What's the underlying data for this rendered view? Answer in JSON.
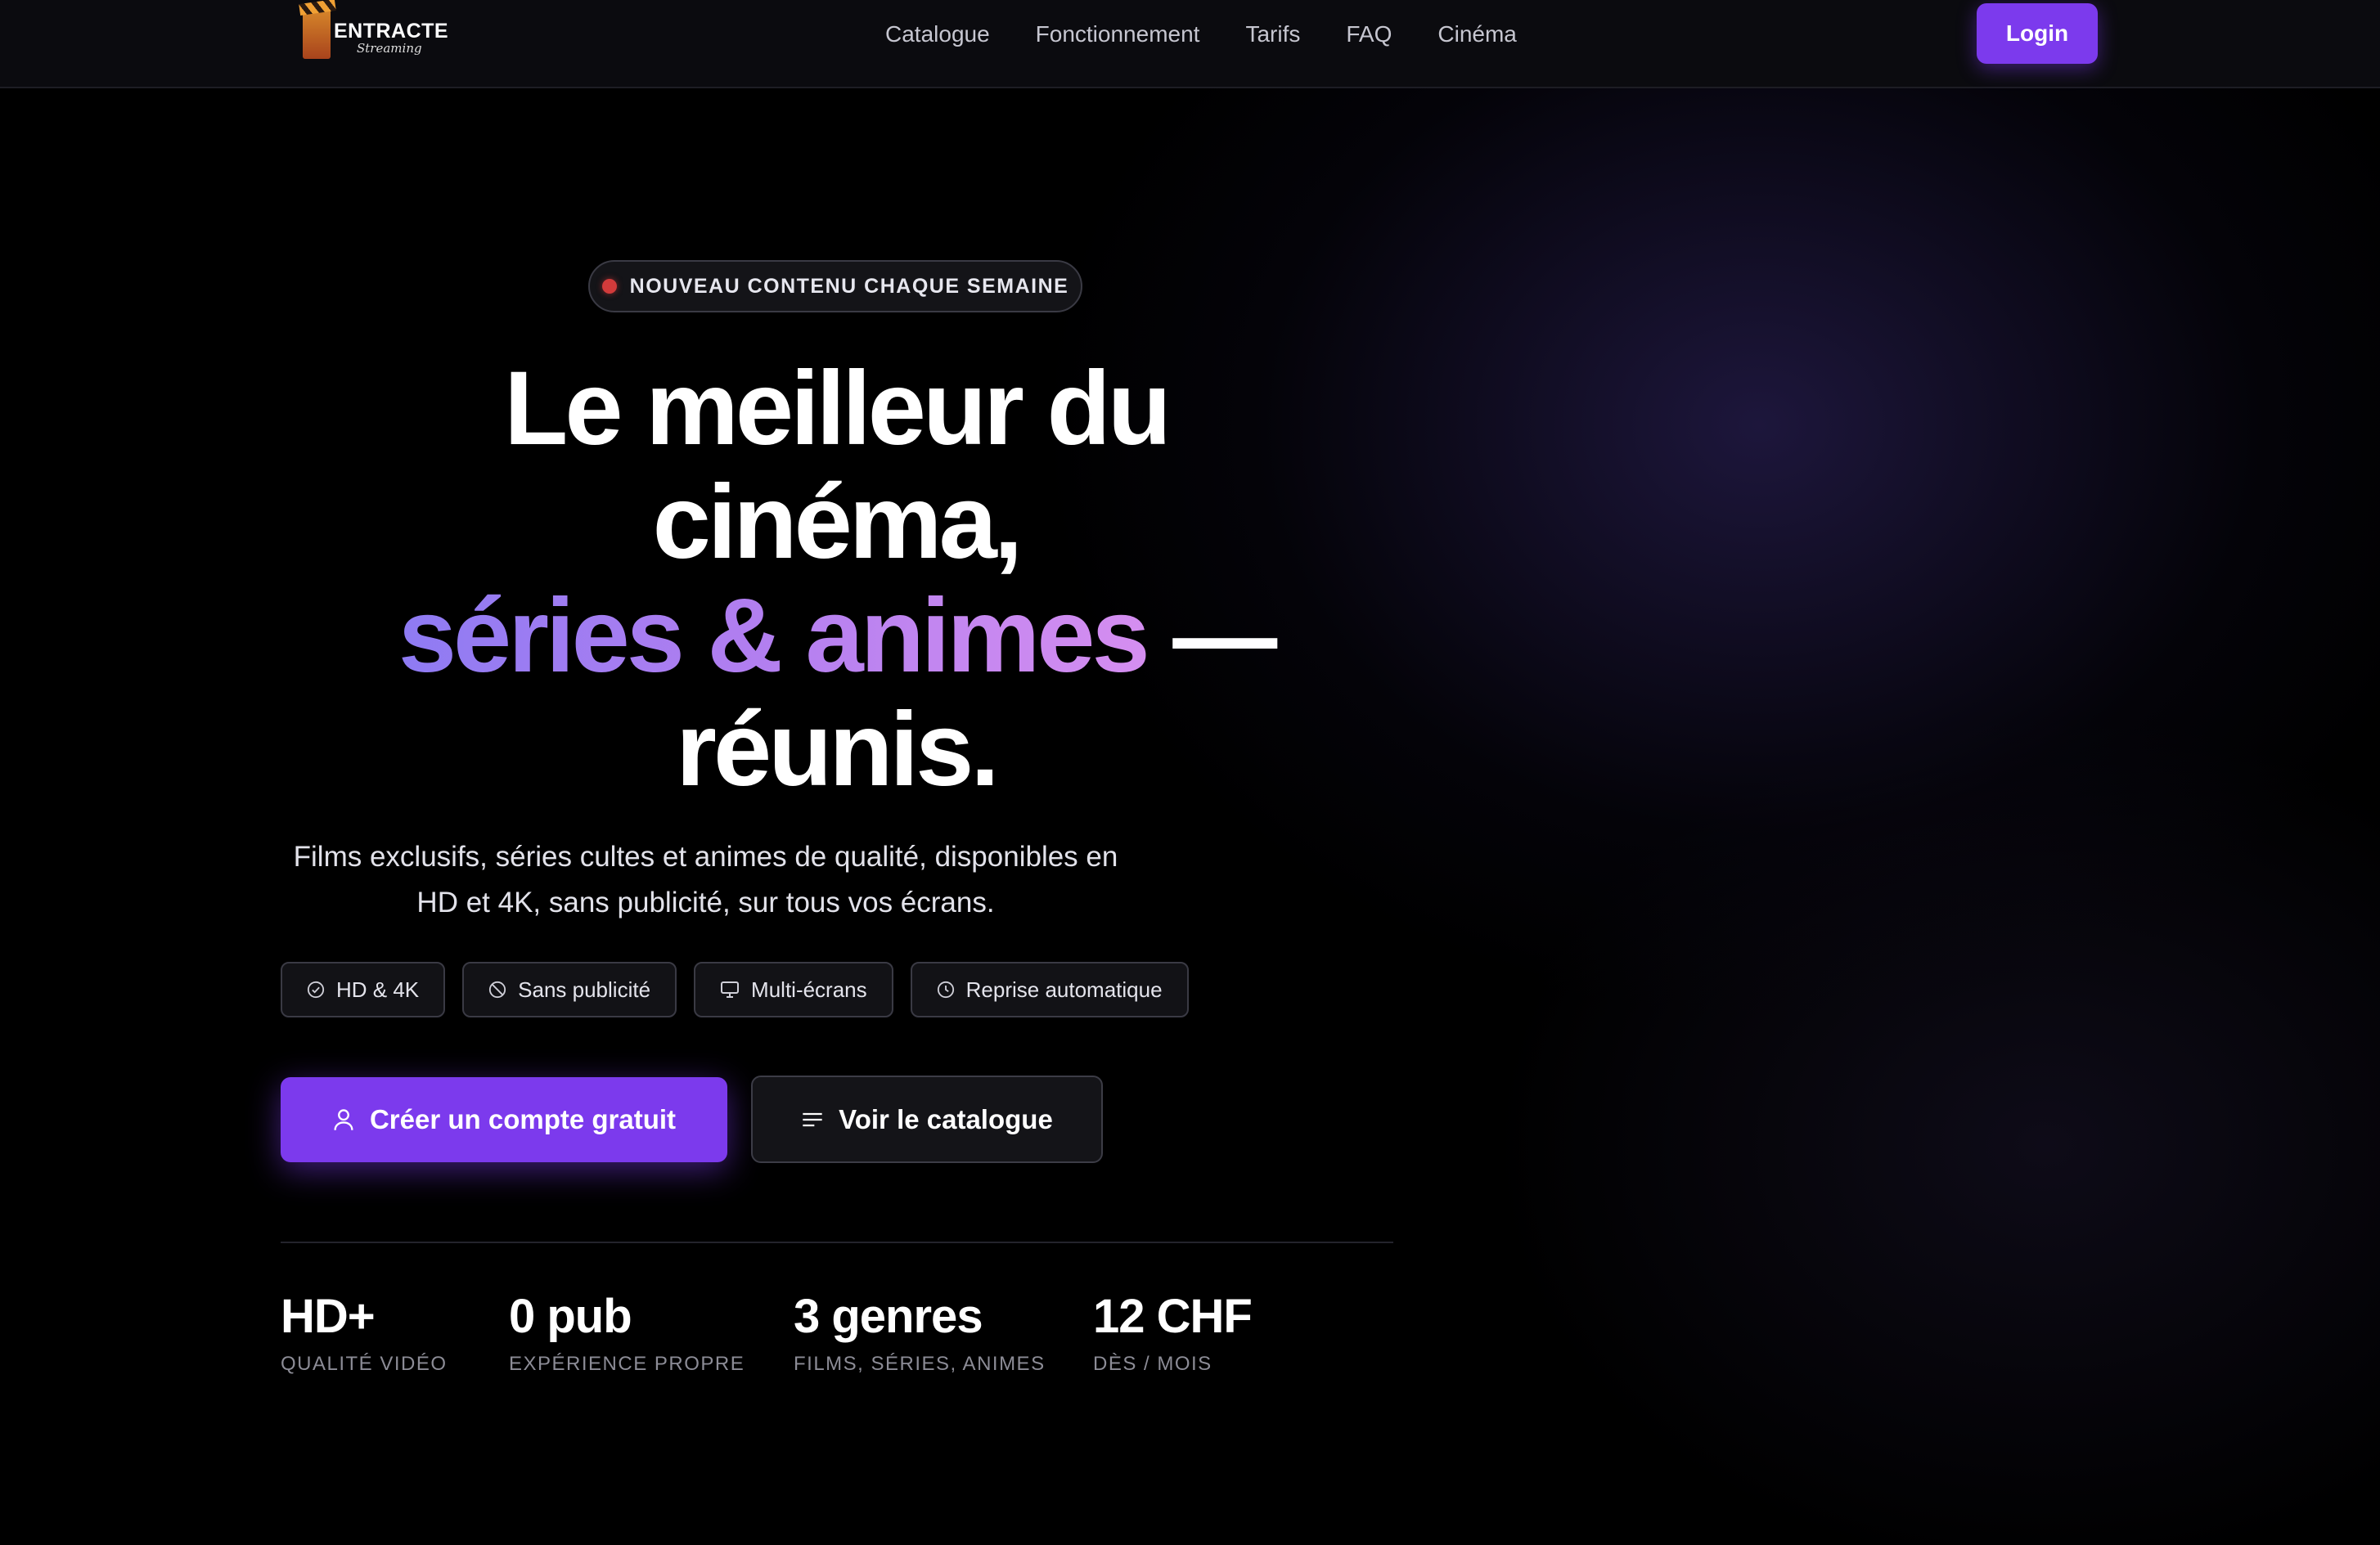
{
  "nav": {
    "logo_title": "ENTRACTE",
    "logo_subtitle": "Streaming",
    "links": [
      "Catalogue",
      "Fonctionnement",
      "Tarifs",
      "FAQ",
      "Cinéma"
    ],
    "login_label": "Login"
  },
  "hero": {
    "badge": "NOUVEAU CONTENU CHAQUE SEMAINE",
    "headline_line1": "Le meilleur du",
    "headline_line2": "cinéma,",
    "headline_gradient": "séries & animes",
    "headline_dash": " —",
    "headline_line4": "réunis.",
    "subtitle": "Films exclusifs, séries cultes et animes de qualité, disponibles en HD et 4K, sans publicité, sur tous vos écrans.",
    "features": [
      {
        "icon": "check-circle-icon",
        "label": "HD & 4K"
      },
      {
        "icon": "no-ads-icon",
        "label": "Sans publicité"
      },
      {
        "icon": "monitor-icon",
        "label": "Multi-écrans"
      },
      {
        "icon": "clock-icon",
        "label": "Reprise automatique"
      }
    ],
    "cta_primary": "Créer un compte gratuit",
    "cta_secondary": "Voir le catalogue"
  },
  "stats": [
    {
      "value": "HD+",
      "label": "QUALITÉ VIDÉO"
    },
    {
      "value": "0 pub",
      "label": "EXPÉRIENCE PROPRE"
    },
    {
      "value": "3 genres",
      "label": "FILMS, SÉRIES, ANIMES"
    },
    {
      "value": "12 CHF",
      "label": "DÈS / MOIS"
    }
  ],
  "colors": {
    "accent": "#7c3aed",
    "background": "#000000",
    "badge_dot": "#d23b3b",
    "gradient_start": "#8e7bf3",
    "gradient_end": "#d58ef0"
  }
}
